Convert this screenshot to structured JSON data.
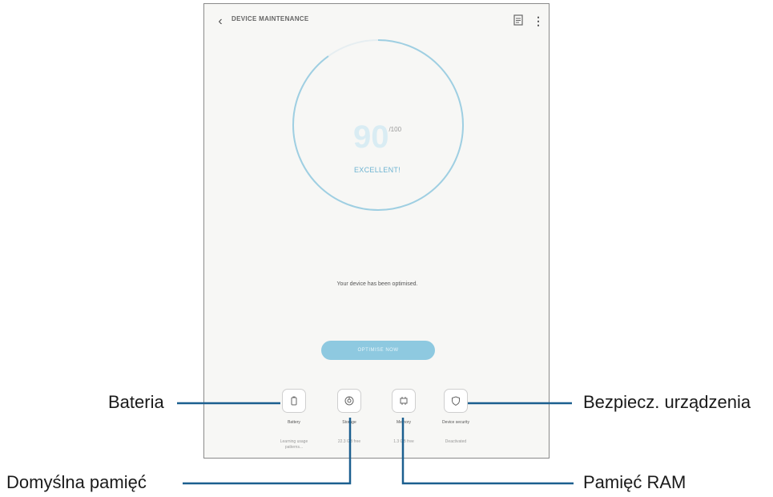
{
  "appbar": {
    "title": "DEVICE MAINTENANCE"
  },
  "score": {
    "value": "90",
    "max": "/100",
    "status": "EXCELLENT!",
    "ring_fraction": 0.9
  },
  "status_message": "Your device has been optimised.",
  "optimise_button": "OPTIMISE NOW",
  "tools": [
    {
      "label": "Battery",
      "sub": "Learning usage patterns..."
    },
    {
      "label": "Storage",
      "sub": "22.3 GB free"
    },
    {
      "label": "Memory",
      "sub": "1.3 GB free"
    },
    {
      "label": "Device security",
      "sub": "Deactivated"
    }
  ],
  "callouts": {
    "battery": "Bateria",
    "storage": "Domyślna pamięć",
    "memory": "Pamięć RAM",
    "security": "Bezpiecz. urządzenia"
  },
  "colors": {
    "accent": "#6fb4d2",
    "ring": "#9fcfe2",
    "button": "#8ec9e0",
    "leader": "#1b5f8f"
  }
}
